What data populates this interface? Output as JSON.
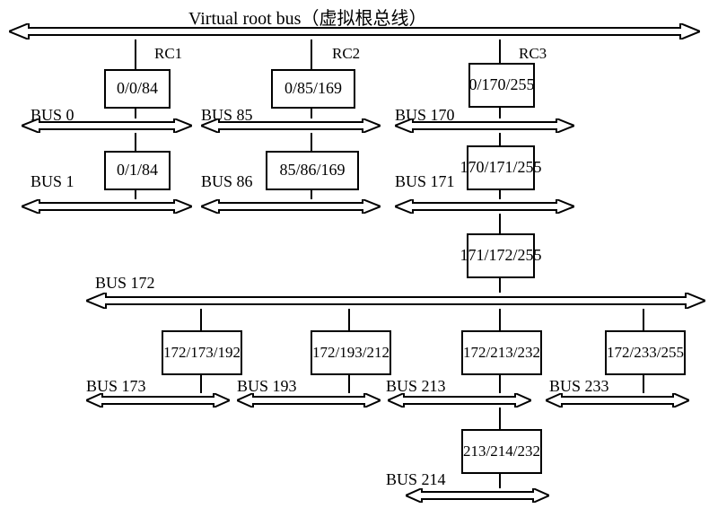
{
  "title": "Virtual root bus（虚拟根总线）",
  "rc": {
    "rc1": "RC1",
    "rc2": "RC2",
    "rc3": "RC3"
  },
  "nodes": {
    "n_rc1_top": "0/0/84",
    "n_rc1_bot": "0/1/84",
    "n_rc2_top": "0/85/169",
    "n_rc2_bot": "85/86/169",
    "n_rc3_top": "0/170/255",
    "n_rc3_bot": "170/171/255",
    "n_rc3_3": "171/172/255",
    "n_b172_1": "172/173/192",
    "n_b172_2": "172/193/212",
    "n_b172_3": "172/213/232",
    "n_b172_4": "172/233/255",
    "n_b213": "213/214/232"
  },
  "buses": {
    "b0": "BUS 0",
    "b1": "BUS 1",
    "b85": "BUS 85",
    "b86": "BUS 86",
    "b170": "BUS 170",
    "b171": "BUS 171",
    "b172": "BUS 172",
    "b173": "BUS 173",
    "b193": "BUS 193",
    "b213": "BUS 213",
    "b214": "BUS 214",
    "b233": "BUS 233"
  },
  "chart_data": {
    "type": "tree",
    "title": "Virtual root bus（虚拟根总线）",
    "root": "virtual_root_bus",
    "root_complexes": [
      "RC1",
      "RC2",
      "RC3"
    ],
    "bridges": [
      {
        "parent_bus": "virtual_root_bus",
        "rc": "RC1",
        "pri_sec_sub": [
          0,
          0,
          84
        ],
        "child_bus": 0
      },
      {
        "parent_bus": 0,
        "pri_sec_sub": [
          0,
          1,
          84
        ],
        "child_bus": 1
      },
      {
        "parent_bus": "virtual_root_bus",
        "rc": "RC2",
        "pri_sec_sub": [
          0,
          85,
          169
        ],
        "child_bus": 85
      },
      {
        "parent_bus": 85,
        "pri_sec_sub": [
          85,
          86,
          169
        ],
        "child_bus": 86
      },
      {
        "parent_bus": "virtual_root_bus",
        "rc": "RC3",
        "pri_sec_sub": [
          0,
          170,
          255
        ],
        "child_bus": 170
      },
      {
        "parent_bus": 170,
        "pri_sec_sub": [
          170,
          171,
          255
        ],
        "child_bus": 171
      },
      {
        "parent_bus": 171,
        "pri_sec_sub": [
          171,
          172,
          255
        ],
        "child_bus": 172
      },
      {
        "parent_bus": 172,
        "pri_sec_sub": [
          172,
          173,
          192
        ],
        "child_bus": 173
      },
      {
        "parent_bus": 172,
        "pri_sec_sub": [
          172,
          193,
          212
        ],
        "child_bus": 193
      },
      {
        "parent_bus": 172,
        "pri_sec_sub": [
          172,
          213,
          232
        ],
        "child_bus": 213
      },
      {
        "parent_bus": 172,
        "pri_sec_sub": [
          172,
          233,
          255
        ],
        "child_bus": 233
      },
      {
        "parent_bus": 213,
        "pri_sec_sub": [
          213,
          214,
          232
        ],
        "child_bus": 214
      }
    ]
  }
}
